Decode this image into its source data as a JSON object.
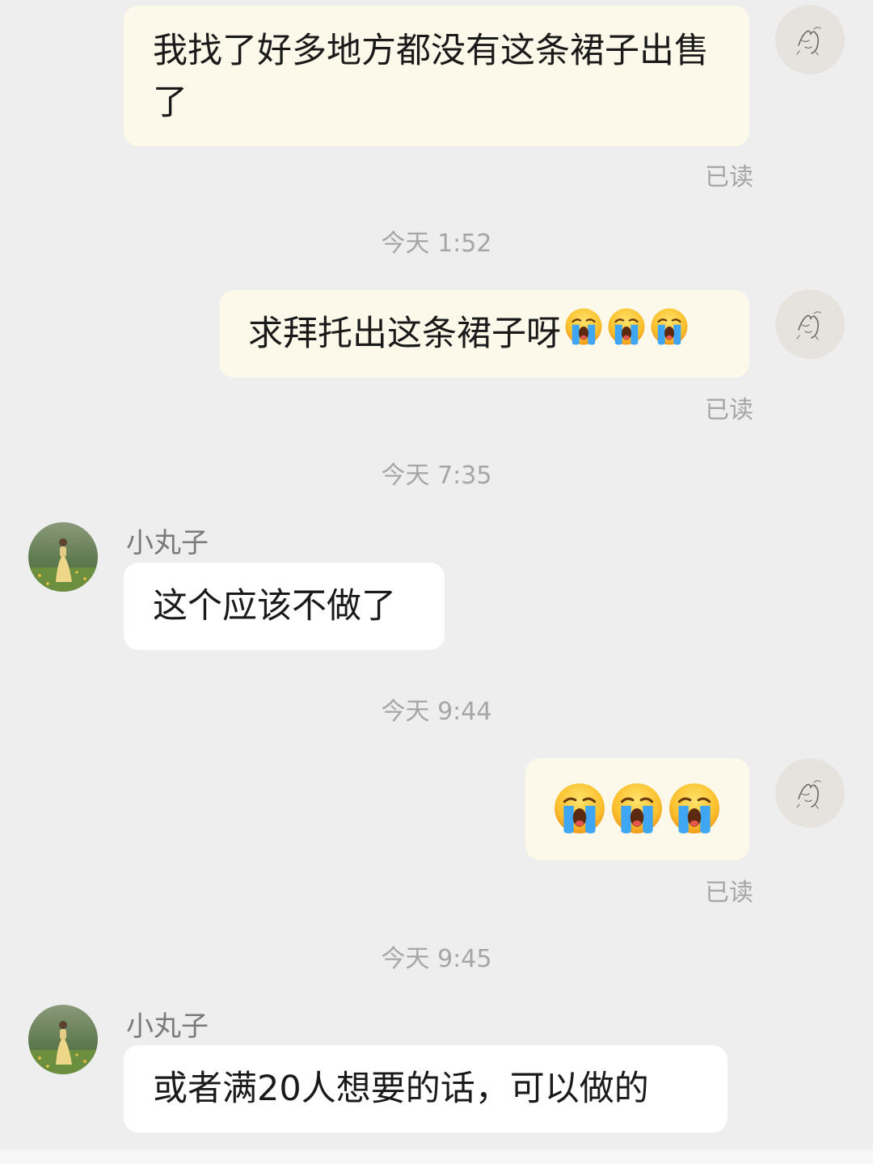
{
  "messages": [
    {
      "sender": "me",
      "text": "我找了好多地方都没有这条裙子出售了",
      "status": "已读"
    },
    {
      "sender": "me",
      "text": "求拜托出这条裙子呀",
      "emoji": "😭😭😭",
      "status": "已读"
    },
    {
      "sender": "小丸子",
      "text": "这个应该不做了"
    },
    {
      "sender": "me",
      "emoji": "😭😭😭",
      "status": "已读"
    },
    {
      "sender": "小丸子",
      "text": "或者满20人想要的话，可以做的"
    }
  ],
  "timestamps": [
    "今天 1:52",
    "今天 7:35",
    "今天 9:44",
    "今天 9:45"
  ],
  "icons": {
    "my_avatar": "sketch-drawing-avatar",
    "their_avatar": "girl-in-dress-meadow-avatar",
    "emoji": "loudly-crying-face-emoji"
  },
  "colors": {
    "background": "#eeeeee",
    "my_bubble": "#fdf9ea",
    "their_bubble": "#ffffff",
    "meta_text": "#a6a6a6"
  }
}
